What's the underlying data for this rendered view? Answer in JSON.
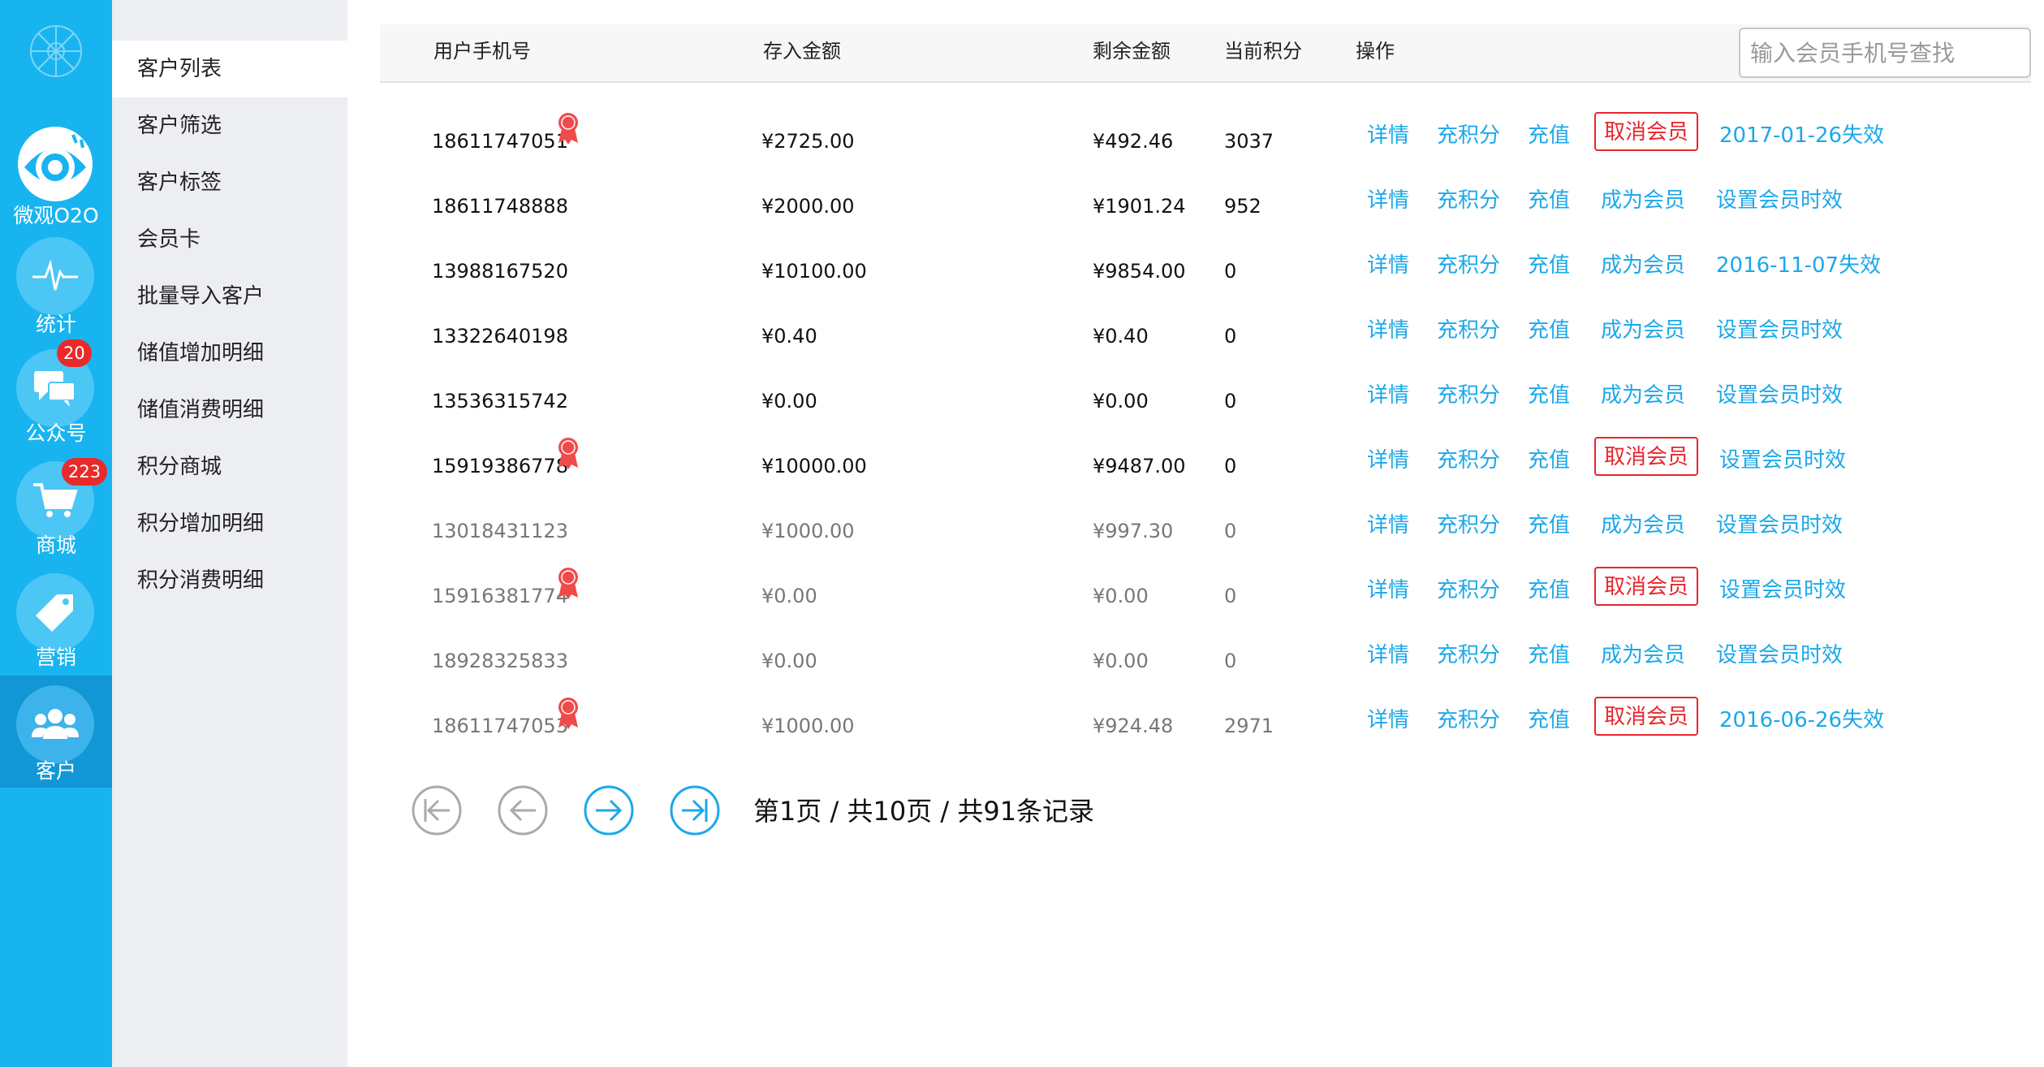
{
  "nav_rail": {
    "items": [
      {
        "label": "微观O2O",
        "icon": "eye-icon"
      },
      {
        "label": "统计",
        "icon": "pulse-icon"
      },
      {
        "label": "公众号",
        "icon": "chat-icon",
        "badge": "20"
      },
      {
        "label": "商城",
        "icon": "cart-icon",
        "badge": "223"
      },
      {
        "label": "营销",
        "icon": "tag-icon"
      },
      {
        "label": "客户",
        "icon": "users-icon",
        "active": true
      }
    ]
  },
  "submenu": {
    "items": [
      "客户列表",
      "客户筛选",
      "客户标签",
      "会员卡",
      "批量导入客户",
      "储值增加明细",
      "储值消费明细",
      "积分商城",
      "积分增加明细",
      "积分消费明细"
    ],
    "active_index": 0
  },
  "table": {
    "headers": {
      "phone": "用户手机号",
      "deposit": "存入金额",
      "remaining": "剩余金额",
      "points": "当前积分",
      "ops": "操作"
    },
    "search_placeholder": "输入会员手机号查找",
    "rows": [
      {
        "phone": "18611747051",
        "member": true,
        "deposit": "¥2725.00",
        "remaining": "¥492.46",
        "points": "3037",
        "member_action": "取消会员",
        "expiry": "2017-01-26失效",
        "dim": false
      },
      {
        "phone": "18611748888",
        "member": false,
        "deposit": "¥2000.00",
        "remaining": "¥1901.24",
        "points": "952",
        "member_action": "成为会员",
        "expiry": "设置会员时效",
        "dim": false
      },
      {
        "phone": "13988167520",
        "member": false,
        "deposit": "¥10100.00",
        "remaining": "¥9854.00",
        "points": "0",
        "member_action": "成为会员",
        "expiry": "2016-11-07失效",
        "dim": false
      },
      {
        "phone": "13322640198",
        "member": false,
        "deposit": "¥0.40",
        "remaining": "¥0.40",
        "points": "0",
        "member_action": "成为会员",
        "expiry": "设置会员时效",
        "dim": false
      },
      {
        "phone": "13536315742",
        "member": false,
        "deposit": "¥0.00",
        "remaining": "¥0.00",
        "points": "0",
        "member_action": "成为会员",
        "expiry": "设置会员时效",
        "dim": false
      },
      {
        "phone": "15919386778",
        "member": true,
        "deposit": "¥10000.00",
        "remaining": "¥9487.00",
        "points": "0",
        "member_action": "取消会员",
        "expiry": "设置会员时效",
        "dim": false
      },
      {
        "phone": "13018431123",
        "member": false,
        "deposit": "¥1000.00",
        "remaining": "¥997.30",
        "points": "0",
        "member_action": "成为会员",
        "expiry": "设置会员时效",
        "dim": true
      },
      {
        "phone": "15916381774",
        "member": true,
        "deposit": "¥0.00",
        "remaining": "¥0.00",
        "points": "0",
        "member_action": "取消会员",
        "expiry": "设置会员时效",
        "dim": true
      },
      {
        "phone": "18928325833",
        "member": false,
        "deposit": "¥0.00",
        "remaining": "¥0.00",
        "points": "0",
        "member_action": "成为会员",
        "expiry": "设置会员时效",
        "dim": true
      },
      {
        "phone": "18611747053",
        "member": true,
        "deposit": "¥1000.00",
        "remaining": "¥924.48",
        "points": "2971",
        "member_action": "取消会员",
        "expiry": "2016-06-26失效",
        "dim": true
      }
    ],
    "ops_labels": {
      "detail": "详情",
      "add_points": "充积分",
      "recharge": "充值"
    }
  },
  "pagination": {
    "info": "第1页 / 共10页 / 共91条记录"
  },
  "colors": {
    "rail": "#18b4f0",
    "rail_active": "#1197d6",
    "link": "#1ba8ea",
    "danger": "#e8262c",
    "badge": "#e92a2a",
    "medal": "#f04b4b"
  }
}
